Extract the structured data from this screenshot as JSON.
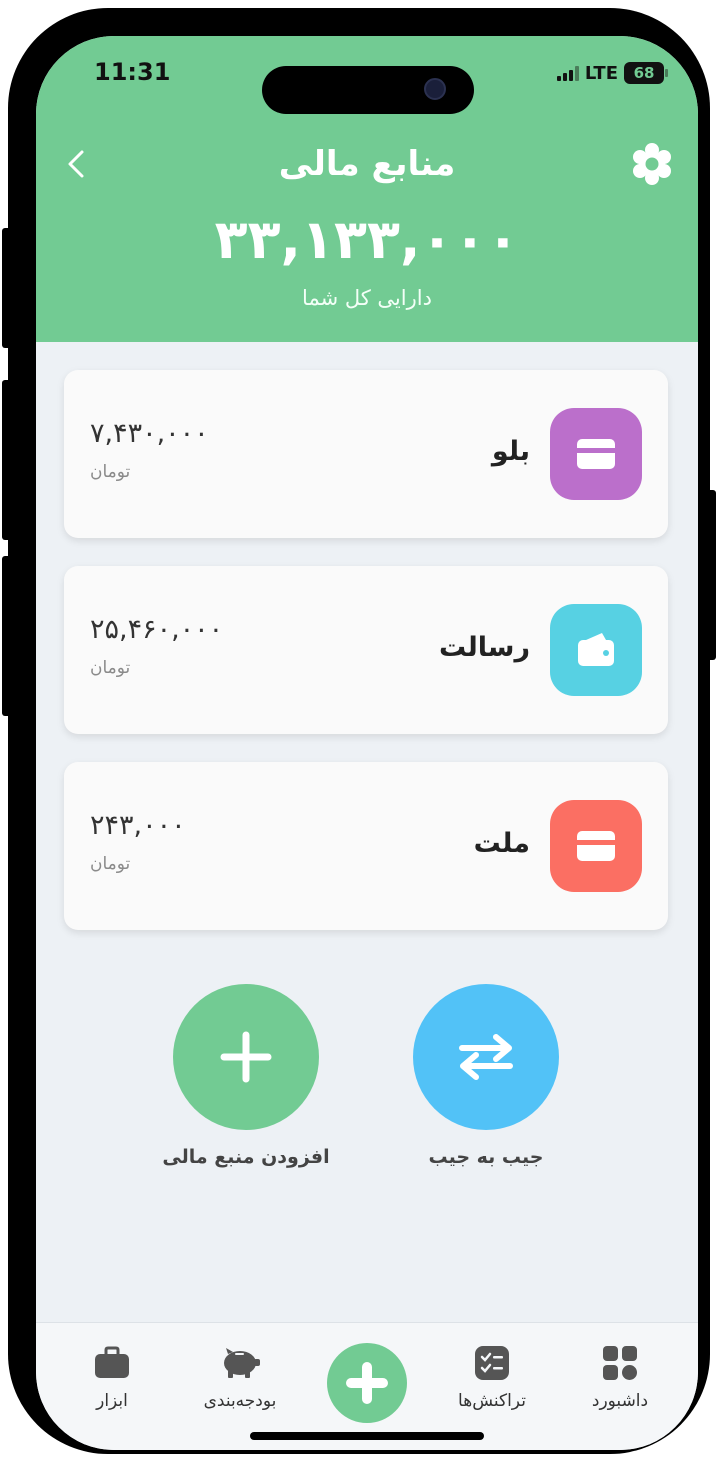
{
  "status_bar": {
    "time": "11:31",
    "network": "LTE",
    "battery": "68"
  },
  "header": {
    "title": "منابع مالی",
    "total_amount": "۳۳,۱۳۳,۰۰۰",
    "total_label": "دارایی کل شما"
  },
  "accounts": [
    {
      "name": "بلو",
      "amount": "۷,۴۳۰,۰۰۰",
      "currency": "تومان",
      "icon": "card-icon",
      "color": "#bb6fcb"
    },
    {
      "name": "رسالت",
      "amount": "۲۵,۴۶۰,۰۰۰",
      "currency": "تومان",
      "icon": "wallet-icon",
      "color": "#57d1e3"
    },
    {
      "name": "ملت",
      "amount": "۲۴۳,۰۰۰",
      "currency": "تومان",
      "icon": "card-icon",
      "color": "#fb6f63"
    }
  ],
  "actions": {
    "add_source": {
      "label": "افزودن منبع مالی",
      "icon": "plus-icon",
      "color": "#72cb93"
    },
    "transfer": {
      "label": "جیب به جیب",
      "icon": "swap-arrows-icon",
      "color": "#52c2f7"
    }
  },
  "tabbar": {
    "tools": "ابزار",
    "budgeting": "بودجه‌بندی",
    "transactions": "تراکنش‌ها",
    "dashboard": "داشبورد"
  },
  "colors": {
    "header": "#72cb93",
    "background": "#edf1f5"
  }
}
